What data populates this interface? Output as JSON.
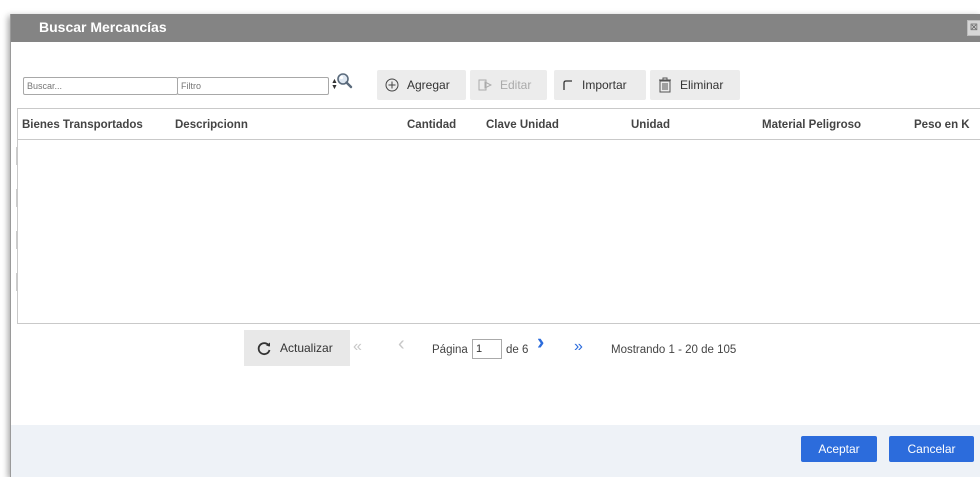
{
  "dialog": {
    "title": "Buscar Mercancías",
    "close_symbol": "⊠"
  },
  "toolbar": {
    "search_placeholder": "Buscar...",
    "filter_placeholder": "Filtro",
    "spinner_symbol": "▲▼",
    "search_icon": "magnifier-icon",
    "add_label": "Agregar",
    "edit_label": "Editar",
    "import_label": "Importar",
    "delete_label": "Eliminar"
  },
  "grid": {
    "columns": [
      "Bienes Transportados",
      "Descripcionn",
      "Cantidad",
      "Clave Unidad",
      "Unidad",
      "Material Peligroso",
      "Peso en K"
    ],
    "rows": []
  },
  "pager": {
    "refresh_label": "Actualizar",
    "page_label": "Página",
    "page_value": "1",
    "of_label": "de 6",
    "first_symbol": "«",
    "prev_symbol": "‹",
    "next_symbol": "›",
    "last_symbol": "»",
    "status": "Mostrando 1 - 20 de 105"
  },
  "footer": {
    "accept_label": "Aceptar",
    "cancel_label": "Cancelar"
  },
  "colors": {
    "titlebar": "#848484",
    "primary_button": "#2c6cdc",
    "nav_active": "#2c6cdc",
    "nav_disabled": "#c8c8c8",
    "footer_bg": "#eef2f7"
  }
}
